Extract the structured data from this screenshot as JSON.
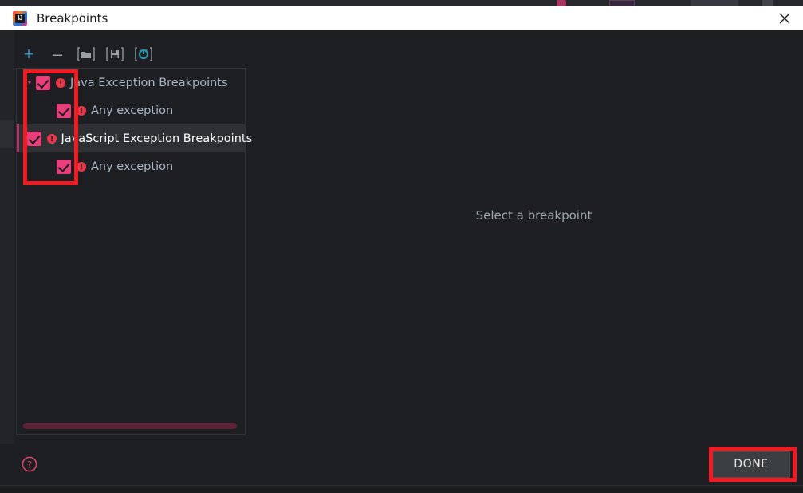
{
  "window": {
    "title": "Breakpoints",
    "logo_icon": "intellij-idea-logo",
    "logo_text": "IJ",
    "close_icon": "close-icon"
  },
  "toolbar": {
    "buttons": [
      {
        "name": "add-breakpoint-button",
        "icon": "plus-icon",
        "glyph": "+"
      },
      {
        "name": "remove-breakpoint-button",
        "icon": "minus-icon",
        "glyph": "–"
      },
      {
        "name": "group-by-file-button",
        "icon": "folder-brackets-icon",
        "glyph": ""
      },
      {
        "name": "save-breakpoints-button",
        "icon": "disk-brackets-icon",
        "glyph": ""
      },
      {
        "name": "restore-breakpoints-button",
        "icon": "circle-brackets-icon",
        "glyph": ""
      }
    ]
  },
  "tree": {
    "rows": [
      {
        "label": "Java Exception Breakpoints",
        "level": 0,
        "expanded": true,
        "checked": true,
        "selected": false,
        "icon": "exception-breakpoint-icon"
      },
      {
        "label": "Any exception",
        "level": 1,
        "expanded": null,
        "checked": true,
        "selected": false,
        "icon": "exception-breakpoint-icon"
      },
      {
        "label": "JavaScript Exception Breakpoints",
        "level": 0,
        "expanded": true,
        "checked": true,
        "selected": true,
        "icon": "exception-breakpoint-icon"
      },
      {
        "label": "Any exception",
        "level": 1,
        "expanded": null,
        "checked": true,
        "selected": false,
        "icon": "exception-breakpoint-icon"
      }
    ],
    "scrollbar": {
      "name": "horizontal-scrollbar",
      "color": "#5c2236"
    }
  },
  "detail": {
    "empty_text": "Select a breakpoint"
  },
  "footer": {
    "help_icon": "help-question-icon",
    "done_label": "DONE"
  },
  "colors": {
    "accent_pink": "#e83e79",
    "exception_red": "#e8374a",
    "annotation_red": "#f21b24",
    "toolbar_blue": "#3592c4",
    "dialog_bg": "#1e1f22",
    "text_primary": "#a9b7c6"
  }
}
